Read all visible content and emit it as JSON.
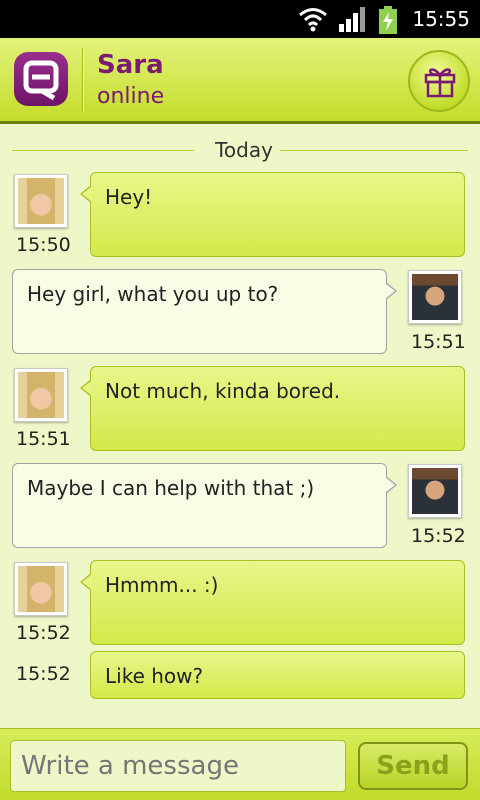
{
  "status_bar": {
    "time": "15:55",
    "icons": [
      "wifi-icon",
      "signal-icon",
      "battery-charging-icon"
    ]
  },
  "header": {
    "contact_name": "Sara",
    "contact_status": "online",
    "logo_icon": "app-logo-icon",
    "gift_icon": "gift-icon"
  },
  "chat": {
    "date_separator": "Today",
    "messages": [
      {
        "sender": "Sara",
        "direction": "incoming",
        "text": "Hey!",
        "time": "15:50"
      },
      {
        "sender": "me",
        "direction": "outgoing",
        "text": "Hey girl, what you up to?",
        "time": "15:51"
      },
      {
        "sender": "Sara",
        "direction": "incoming",
        "text": "Not much, kinda bored.",
        "time": "15:51"
      },
      {
        "sender": "me",
        "direction": "outgoing",
        "text": "Maybe I can help with that ;)",
        "time": "15:52"
      },
      {
        "sender": "Sara",
        "direction": "incoming",
        "text": "Hmmm... :)",
        "time": "15:52"
      },
      {
        "sender": "Sara",
        "direction": "incoming",
        "text": "Like how?",
        "time": "15:52"
      }
    ]
  },
  "composer": {
    "placeholder": "Write a message",
    "send_label": "Send"
  },
  "colors": {
    "header_green": "#c4dd2b",
    "brand_purple": "#7a1a72",
    "chat_background": "#eef7c8",
    "incoming_bubble": "#d3e94a",
    "outgoing_bubble": "#f9fde6"
  }
}
